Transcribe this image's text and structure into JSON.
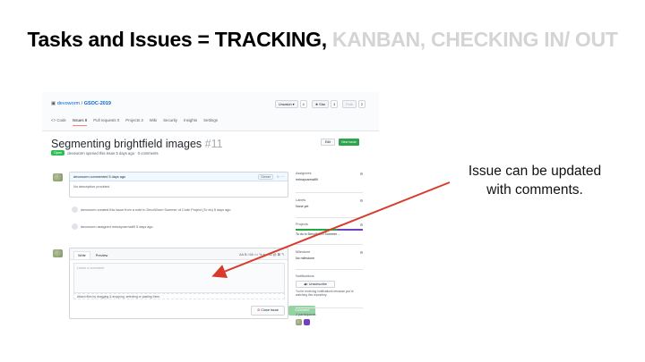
{
  "slide": {
    "title_main": "Tasks and Issues = TRACKING,",
    "title_faded": " KANBAN, CHECKING IN/ OUT",
    "callout": "Issue can be updated with comments.",
    "arrow_color": "#d83b2b"
  },
  "github": {
    "owner": "devoworm",
    "repo": "GSOC-2019",
    "unwatch_label": "Unwatch ▾",
    "unwatch_count": "4",
    "star_label": "★ Star",
    "star_count": "3",
    "fork_label": "Fork",
    "fork_count": "2",
    "tabs": [
      "<> Code",
      "Issues 8",
      "Pull requests 0",
      "Projects 3",
      "Wiki",
      "Security",
      "Insights",
      "Settings"
    ],
    "issue_title": "Segmenting brightfield images",
    "issue_number": "#11",
    "edit_label": "Edit",
    "new_issue_label": "New issue",
    "status": "Open",
    "opened_text": "devoworm opened this issue 5 days ago · 0 comments",
    "comment_header": "devoworm commented 5 days ago",
    "owner_badge": "Owner",
    "comment_body": "No description provided.",
    "event1": "devoworm created this issue from a note in DevoWorm Summer of Code Project (To do) 5 days ago",
    "event2": "devoworm assigned mrinayvarma89 5 days ago",
    "write_tab": "Write",
    "preview_tab": "Preview",
    "toolbar_icons": "AA B i  66 <> %   ≡ ≡ ☑   @ ⊠ ↰",
    "comment_placeholder": "Leave a comment",
    "attach_text": "Attach files by dragging & dropping, selecting or pasting them.",
    "close_issue_label": "Close issue",
    "comment_button_label": "Comment",
    "sidebar": {
      "assignees_title": "Assignees",
      "assignee": "mrinayvarma89",
      "labels_title": "Labels",
      "labels_value": "None yet",
      "projects_title": "Projects",
      "projects_value": "To do in DevoWorm Summer ...",
      "milestone_title": "Milestone",
      "milestone_value": "No milestone",
      "notifications_title": "Notifications",
      "unsubscribe_label": "Unsubscribe",
      "notif_text": "You're receiving notifications because you're watching this repository.",
      "participants_title": "2 participants"
    }
  }
}
